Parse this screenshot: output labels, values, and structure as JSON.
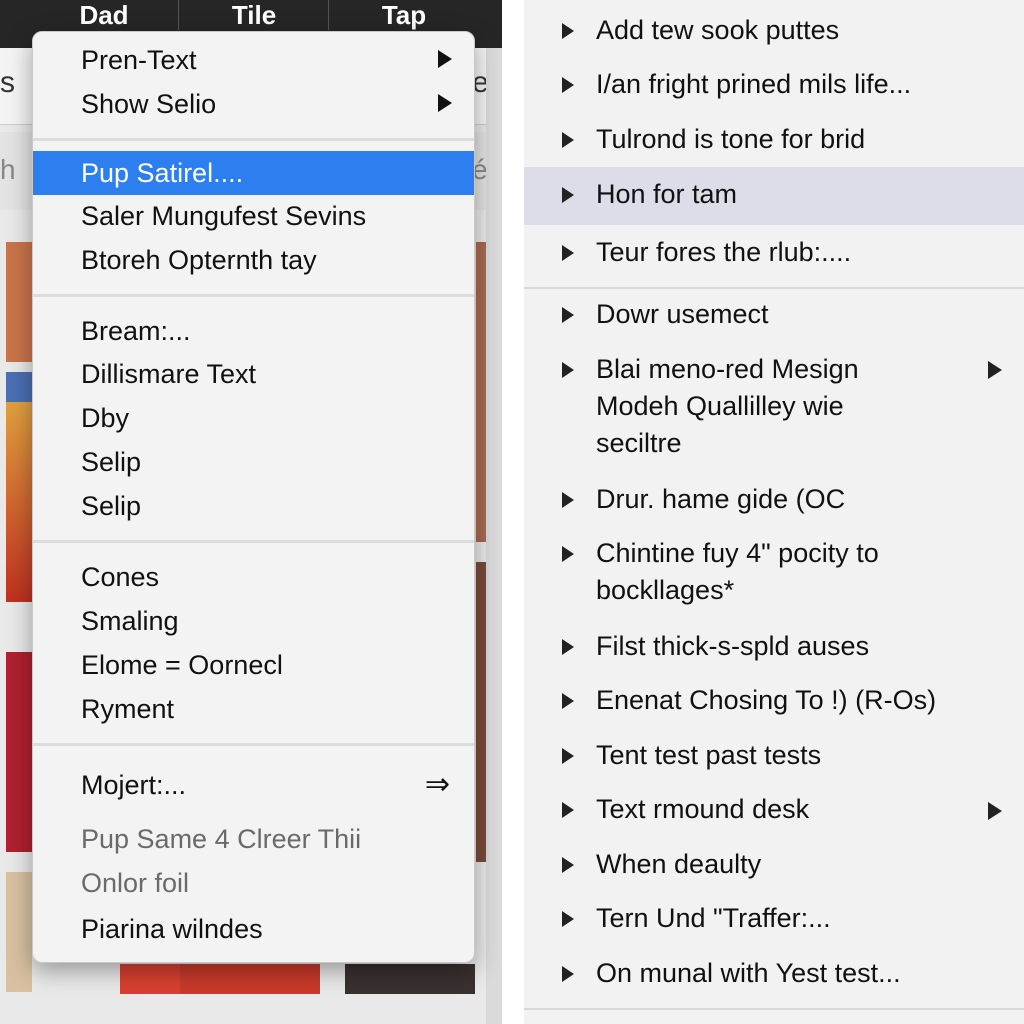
{
  "menubar": {
    "items": [
      {
        "label": "Dad"
      },
      {
        "label": "Tile"
      },
      {
        "label": "Tap"
      }
    ]
  },
  "context_menu": {
    "groups": [
      [
        {
          "label": "Pren-Text",
          "submenu": true
        },
        {
          "label": "Show Selio",
          "submenu": true
        }
      ],
      [
        {
          "label": "Pup Satirel....",
          "highlighted": true
        },
        {
          "label": "Saler Mungufest Sevins"
        },
        {
          "label": "Btoreh Opternth tay"
        }
      ],
      [
        {
          "label": "Bream:..."
        },
        {
          "label": "Dillismare Text"
        },
        {
          "label": "Dby"
        },
        {
          "label": "Selip"
        },
        {
          "label": "Selip"
        }
      ],
      [
        {
          "label": "Cones"
        },
        {
          "label": "Smaling"
        },
        {
          "label": "Elome = Oornecl"
        },
        {
          "label": "Ryment"
        }
      ],
      [
        {
          "label": "Mojert:...",
          "arrow": "⇒"
        },
        {
          "label": "Pup Same 4 Clreer Thii",
          "dimmed": true
        },
        {
          "label": "Onlor foil",
          "dimmed": true
        },
        {
          "label": "Piarina wilndes"
        }
      ]
    ]
  },
  "right_list": {
    "items": [
      {
        "label": "Add tew sook puttes"
      },
      {
        "label": "I/an fright prined mils life..."
      },
      {
        "label": "Tulrond is tone for brid"
      },
      {
        "label": "Hon for tam",
        "highlighted": true
      },
      {
        "label": "Teur fores the rlub:...."
      },
      {
        "label": "Dowr usemect"
      },
      {
        "label": "Blai meno-red Mesign Modeh Quallilley wie seciltre",
        "submenu": true
      },
      {
        "label": "Drur. hame gide (OC"
      },
      {
        "label": "Chintine fuy 4\" pocity to bockllages*"
      },
      {
        "label": "Filst thick-s-spld auses"
      },
      {
        "label": "Enenat Chosing To !) (R-Os)"
      },
      {
        "label": "Tent test past tests"
      },
      {
        "label": "Text rmound desk",
        "submenu": true
      },
      {
        "label": "When deaulty"
      },
      {
        "label": "Tern Und \"Traffer:..."
      },
      {
        "label": "On munal with Yest test..."
      }
    ]
  },
  "background_fragments": {
    "toolbar_left": "s",
    "toolbar_right": "er",
    "search_left": "h",
    "search_right": "é"
  },
  "colors": {
    "highlight": "#2d7ff0",
    "right_highlight": "#dcdde9",
    "menubar": "#262626"
  }
}
